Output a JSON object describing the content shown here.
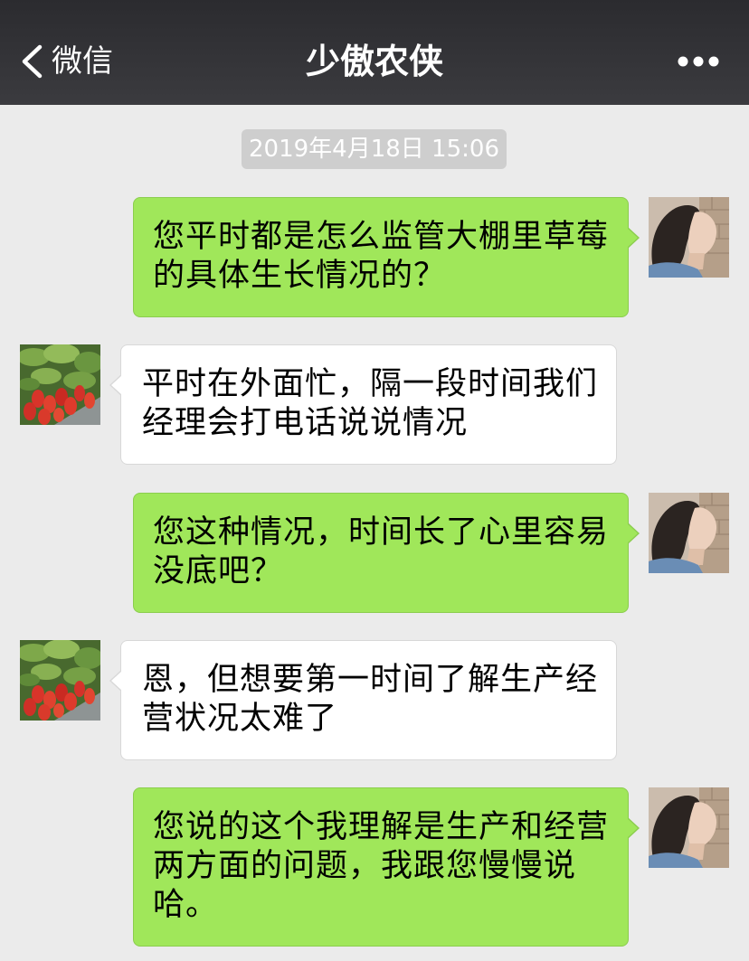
{
  "header": {
    "back_label": "微信",
    "back_icon": "chevron-left-icon",
    "title": "少傲农侠",
    "more_icon": "more-dots-icon"
  },
  "timestamp": "2019年4月18日 15:06",
  "messages": [
    {
      "outgoing": true,
      "lines": [
        "您平时都是怎么监管大棚里草莓",
        "的具体生长情况的？"
      ]
    },
    {
      "outgoing": false,
      "lines": [
        "平时在外面忙，隔一段时间我们",
        "经理会打电话说说情况"
      ]
    },
    {
      "outgoing": true,
      "lines": [
        "您这种情况，时间长了心里容易",
        "没底吧？"
      ]
    },
    {
      "outgoing": false,
      "lines": [
        "恩，但想要第一时间了解生产经",
        "营状况太难了"
      ]
    },
    {
      "outgoing": true,
      "lines": [
        "您说的这个我理解是生产和经营",
        "两方面的问题，我跟您慢慢说",
        "哈。"
      ]
    }
  ],
  "colors": {
    "chat_bg": "#ebebeb",
    "outgoing_bubble": "#a0e75a",
    "outgoing_border": "#8bcd4e",
    "incoming_bubble": "#ffffff",
    "incoming_border": "#d8d8d8",
    "timestamp_bg": "#cecece"
  }
}
